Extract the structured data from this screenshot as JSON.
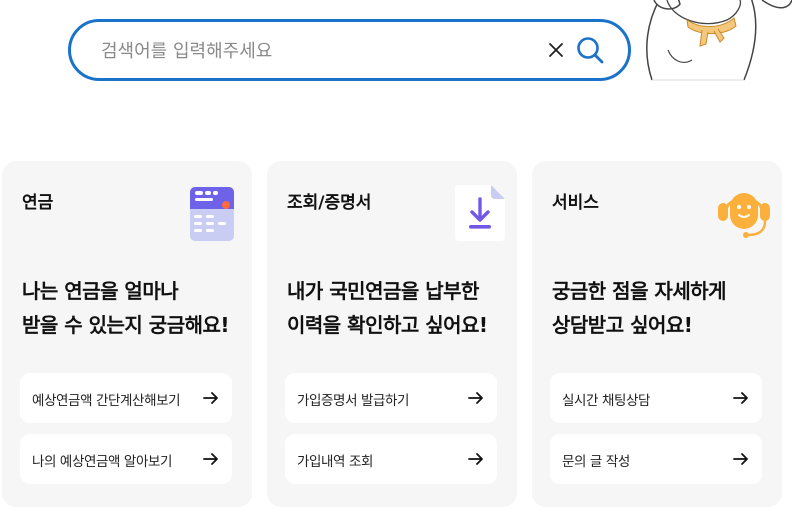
{
  "search": {
    "placeholder": "검색어를 입력해주세요",
    "value": ""
  },
  "colors": {
    "accent": "#1b73c9",
    "card_bg": "#f6f6f6",
    "icon_purple": "#7358e6",
    "icon_orange": "#fbb03b"
  },
  "cards": [
    {
      "title": "연금",
      "icon": "pension-card-icon",
      "desc_line1": "나는 연금을 얼마나",
      "desc_line2": "받을 수 있는지 궁금해요!",
      "links": [
        {
          "label": "예상연금액 간단계산해보기",
          "icon": "arrow-right-icon"
        },
        {
          "label": "나의 예상연금액 알아보기",
          "icon": "arrow-right-icon"
        }
      ]
    },
    {
      "title": "조회/증명서",
      "icon": "document-download-icon",
      "desc_line1": "내가 국민연금을 납부한",
      "desc_line2": "이력을 확인하고 싶어요!",
      "links": [
        {
          "label": "가입증명서 발급하기",
          "icon": "arrow-right-icon"
        },
        {
          "label": "가입내역 조회",
          "icon": "arrow-right-icon"
        }
      ]
    },
    {
      "title": "서비스",
      "icon": "headset-agent-icon",
      "desc_line1": "궁금한 점을 자세하게",
      "desc_line2": "상담받고 싶어요!",
      "links": [
        {
          "label": "실시간 채팅상담",
          "icon": "arrow-right-icon"
        },
        {
          "label": "문의 글 작성",
          "icon": "arrow-right-icon"
        }
      ]
    }
  ]
}
